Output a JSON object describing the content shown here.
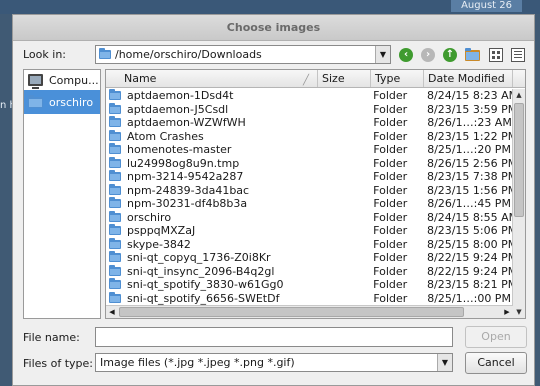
{
  "background": {
    "date_label": "August 26",
    "side_text": "n h"
  },
  "dialog": {
    "title": "Choose images",
    "look_in_label": "Look in:",
    "look_in_path": "/home/orschiro/Downloads",
    "sidebar": [
      {
        "label": "Compu...",
        "icon": "computer-icon"
      },
      {
        "label": "orschiro",
        "icon": "folder-icon"
      }
    ],
    "columns": {
      "name": "Name",
      "size": "Size",
      "type": "Type",
      "date": "Date Modified"
    },
    "files": [
      {
        "name": "aptdaemon-1Dsd4t",
        "size": "",
        "type": "Folder",
        "date": "8/24/15 8:23 AM"
      },
      {
        "name": "aptdaemon-J5Csdl",
        "size": "",
        "type": "Folder",
        "date": "8/23/15 3:59 PM"
      },
      {
        "name": "aptdaemon-WZWfWH",
        "size": "",
        "type": "Folder",
        "date": "8/26/1…:23 AM"
      },
      {
        "name": "Atom Crashes",
        "size": "",
        "type": "Folder",
        "date": "8/23/15 1:22 PM"
      },
      {
        "name": "homenotes-master",
        "size": "",
        "type": "Folder",
        "date": "8/25/1…:20 PM"
      },
      {
        "name": "lu24998og8u9n.tmp",
        "size": "",
        "type": "Folder",
        "date": "8/26/15 2:56 PM"
      },
      {
        "name": "npm-3214-9542a287",
        "size": "",
        "type": "Folder",
        "date": "8/23/15 7:38 PM"
      },
      {
        "name": "npm-24839-3da41bac",
        "size": "",
        "type": "Folder",
        "date": "8/23/15 1:56 PM"
      },
      {
        "name": "npm-30231-df4b8b3a",
        "size": "",
        "type": "Folder",
        "date": "8/26/1…:45 PM"
      },
      {
        "name": "orschiro",
        "size": "",
        "type": "Folder",
        "date": "8/24/15 8:55 AM"
      },
      {
        "name": "psppqMXZaJ",
        "size": "",
        "type": "Folder",
        "date": "8/23/15 5:06 PM"
      },
      {
        "name": "skype-3842",
        "size": "",
        "type": "Folder",
        "date": "8/25/15 8:00 PM"
      },
      {
        "name": "sni-qt_copyq_1736-Z0i8Kr",
        "size": "",
        "type": "Folder",
        "date": "8/22/15 9:24 PM"
      },
      {
        "name": "sni-qt_insync_2096-B4q2gl",
        "size": "",
        "type": "Folder",
        "date": "8/22/15 9:24 PM"
      },
      {
        "name": "sni-qt_spotify_3830-w61Gg0",
        "size": "",
        "type": "Folder",
        "date": "8/23/15 8:21 PM"
      },
      {
        "name": "sni-qt_spotify_6656-SWEtDf",
        "size": "",
        "type": "Folder",
        "date": "8/25/1…:00 PM"
      }
    ],
    "file_name_label": "File name:",
    "file_name_value": "",
    "files_of_type_label": "Files of type:",
    "files_of_type_value": "Image files (*.jpg *.jpeg *.png *.gif)",
    "open_label": "Open",
    "cancel_label": "Cancel"
  }
}
